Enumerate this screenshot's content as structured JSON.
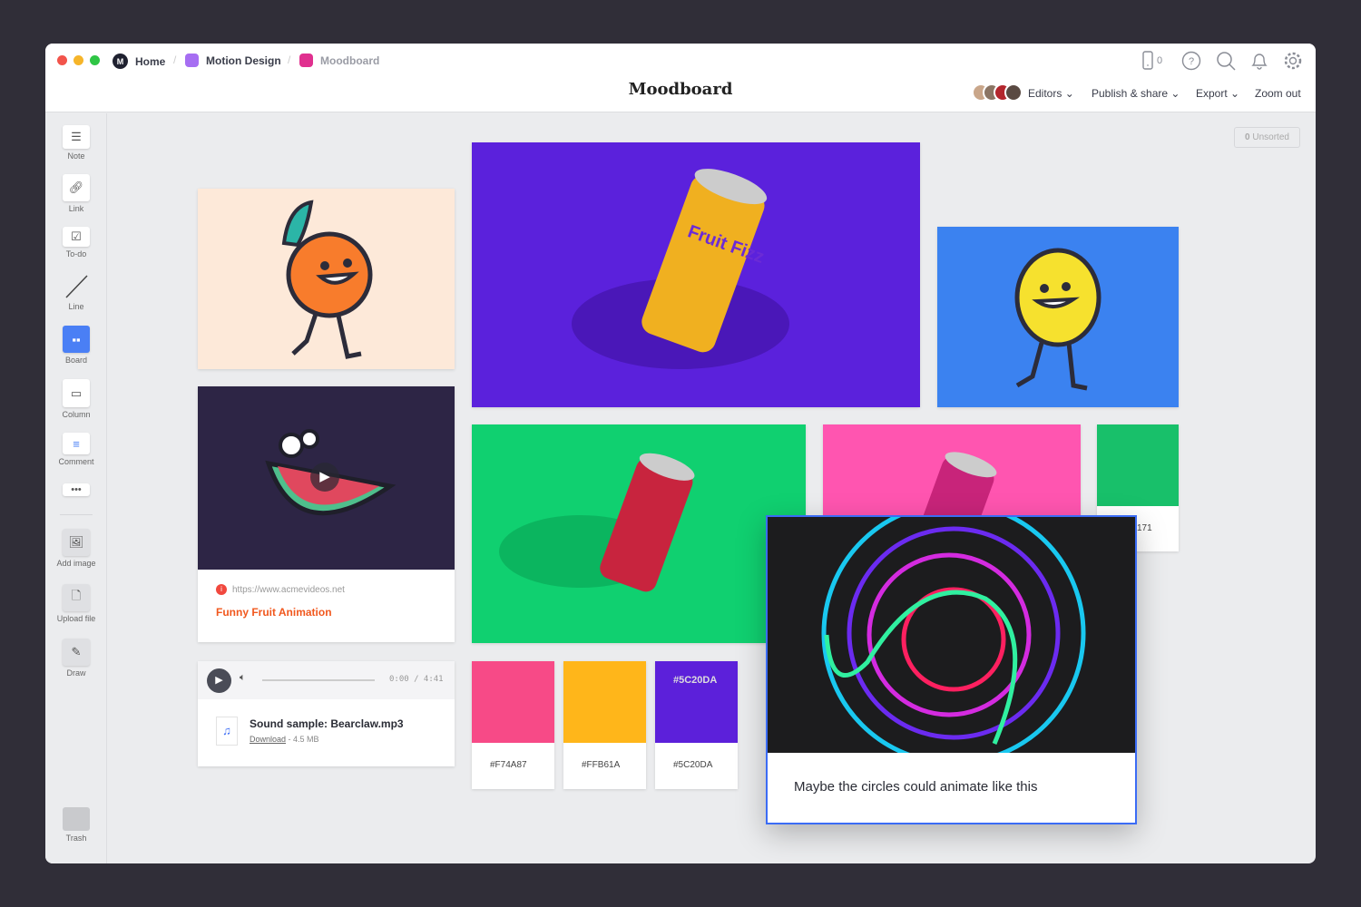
{
  "breadcrumb": {
    "home": "Home",
    "project": "Motion Design",
    "current": "Moodboard"
  },
  "colors": {
    "project": "#a66ef2",
    "current": "#e0308f",
    "accent": "#3b6cf5"
  },
  "header": {
    "title": "Moodboard",
    "device_count": "0",
    "editors": "Editors",
    "publish": "Publish & share",
    "export": "Export",
    "zoom": "Zoom out"
  },
  "unsorted": {
    "count": "0",
    "label": "Unsorted"
  },
  "sidebar": [
    {
      "label": "Note"
    },
    {
      "label": "Link"
    },
    {
      "label": "To-do"
    },
    {
      "label": "Line"
    },
    {
      "label": "Board"
    },
    {
      "label": "Column"
    },
    {
      "label": "Comment"
    },
    {
      "label": "Add image"
    },
    {
      "label": "Upload file"
    },
    {
      "label": "Draw"
    },
    {
      "label": "Trash"
    }
  ],
  "video_card": {
    "url": "https://www.acmevideos.net",
    "title": "Funny Fruit Animation"
  },
  "audio_card": {
    "time": "0:00 / 4:41",
    "name": "Sound sample: Bearclaw.mp3",
    "download": "Download",
    "size": "- 4.5 MB"
  },
  "swatches": [
    {
      "hex": "#F74A87",
      "label": "#F74A87"
    },
    {
      "hex": "#FFB61A",
      "label": "#FFB61A"
    },
    {
      "hex": "#5C20DA",
      "label": "#5C20DA",
      "overlay": "#5C20DA"
    }
  ],
  "green_card": {
    "label": "171"
  },
  "can_text": "Fruit Fizz",
  "popup": {
    "caption": "Maybe the circles could animate like this"
  }
}
